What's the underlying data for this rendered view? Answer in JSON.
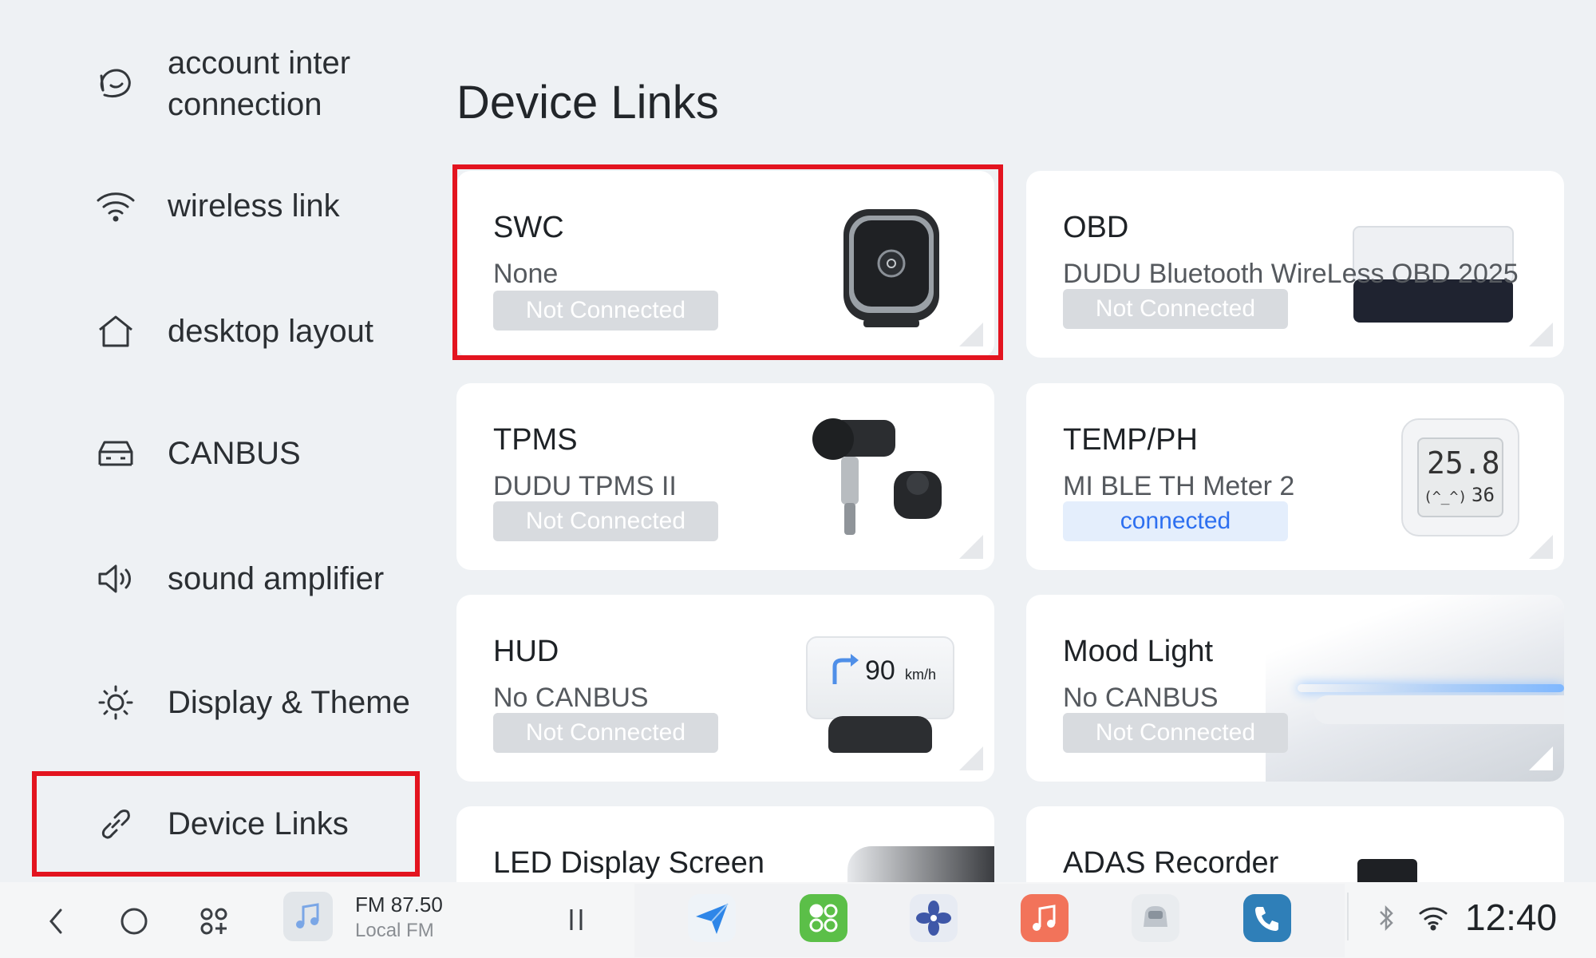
{
  "sidebar": {
    "items": [
      {
        "label": "account inter connection",
        "icon": "account-link-icon"
      },
      {
        "label": "wireless link",
        "icon": "wifi-icon"
      },
      {
        "label": "desktop layout",
        "icon": "home-icon"
      },
      {
        "label": "CANBUS",
        "icon": "car-icon"
      },
      {
        "label": "sound amplifier",
        "icon": "speaker-icon"
      },
      {
        "label": "Display & Theme",
        "icon": "brightness-icon"
      },
      {
        "label": "Device Links",
        "icon": "link-icon",
        "selected": true
      }
    ]
  },
  "main": {
    "title": "Device Links",
    "cards": [
      {
        "name": "SWC",
        "sub": "None",
        "status": "Not Connected",
        "connected": false,
        "highlighted": true
      },
      {
        "name": "OBD",
        "sub": "DUDU Bluetooth WireLess OBD 2025",
        "status": "Not Connected",
        "connected": false
      },
      {
        "name": "TPMS",
        "sub": "DUDU TPMS II",
        "status": "Not Connected",
        "connected": false
      },
      {
        "name": "TEMP/PH",
        "sub": "MI BLE TH Meter 2",
        "status": "connected",
        "connected": true,
        "display_reading": "25.8",
        "display_face": "(^_^)",
        "display_humidity": "36"
      },
      {
        "name": "HUD",
        "sub": "No CANBUS",
        "status": "Not Connected",
        "connected": false,
        "speed": "90",
        "speed_unit": "km/h"
      },
      {
        "name": "Mood Light",
        "sub": "No CANBUS",
        "status": "Not Connected",
        "connected": false
      },
      {
        "name": "LED Display Screen",
        "sub": "",
        "status": "",
        "connected": false
      },
      {
        "name": "ADAS Recorder",
        "sub": "",
        "status": "",
        "connected": false
      }
    ]
  },
  "dock": {
    "radio_title": "FM 87.50",
    "radio_sub": "Local FM",
    "clock": "12:40",
    "apps": [
      "navigation-app-icon",
      "apps-grid-app-icon",
      "fan-app-icon",
      "music-app-icon",
      "car-app-icon",
      "phone-app-icon"
    ]
  },
  "colors": {
    "highlight": "#e3141f",
    "connected_text": "#2d6ff0",
    "background": "#eef1f4"
  }
}
